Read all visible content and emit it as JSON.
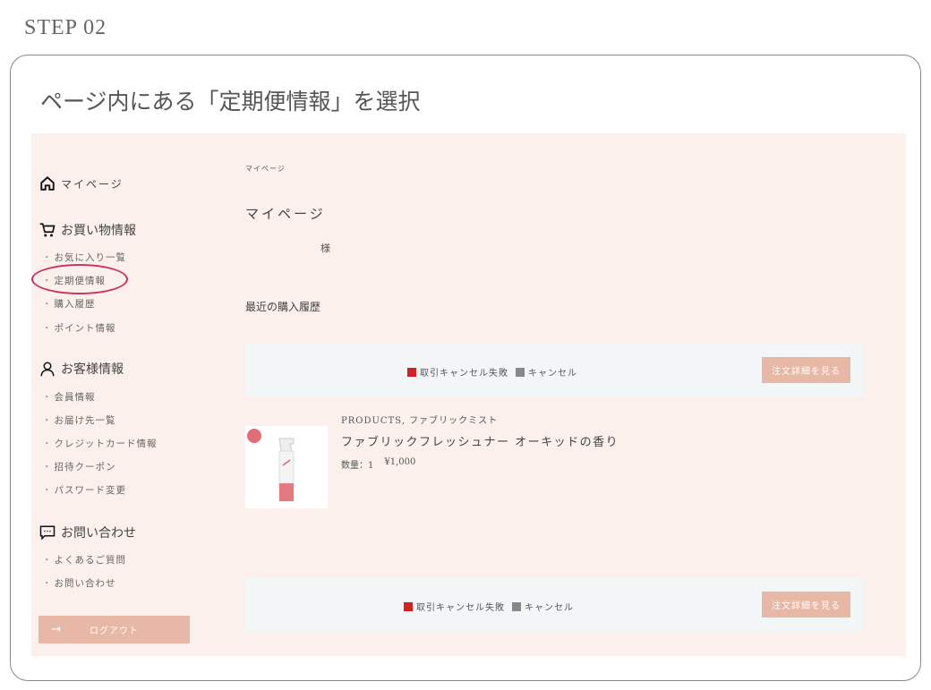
{
  "step_label": "STEP 02",
  "instruction": "ページ内にある「定期便情報」を選択",
  "sidebar": {
    "mypage": "マイページ",
    "shopping": {
      "title": "お買い物情報",
      "items": [
        "お気に入り一覧",
        "定期便情報",
        "購入履歴",
        "ポイント情報"
      ]
    },
    "customer": {
      "title": "お客様情報",
      "items": [
        "会員情報",
        "お届け先一覧",
        "クレジットカード情報",
        "招待クーポン",
        "パスワード変更"
      ]
    },
    "contact": {
      "title": "お問い合わせ",
      "items": [
        "よくあるご質問",
        "お問い合わせ"
      ]
    },
    "logout": "ログアウト",
    "highlight_color": "#c9335f"
  },
  "main": {
    "breadcrumb": "マイページ",
    "heading": "マイページ",
    "honorific": "様",
    "recent_title": "最近の購入履歴",
    "orders": [
      {
        "status_failed": "取引キャンセル失敗",
        "status_cancel": "キャンセル",
        "detail_button": "注文詳細を見る",
        "product": {
          "category": "PRODUCTS, ファブリックミスト",
          "name": "ファブリックフレッシュナー オーキッドの香り",
          "qty_label": "数量：1",
          "price": "¥1,000"
        }
      },
      {
        "status_failed": "取引キャンセル失敗",
        "status_cancel": "キャンセル",
        "detail_button": "注文詳細を見る"
      }
    ]
  },
  "colors": {
    "panel": "#fbf0eb",
    "button": "#e7b8a6",
    "failed": "#d62020",
    "cancel": "#888888"
  }
}
